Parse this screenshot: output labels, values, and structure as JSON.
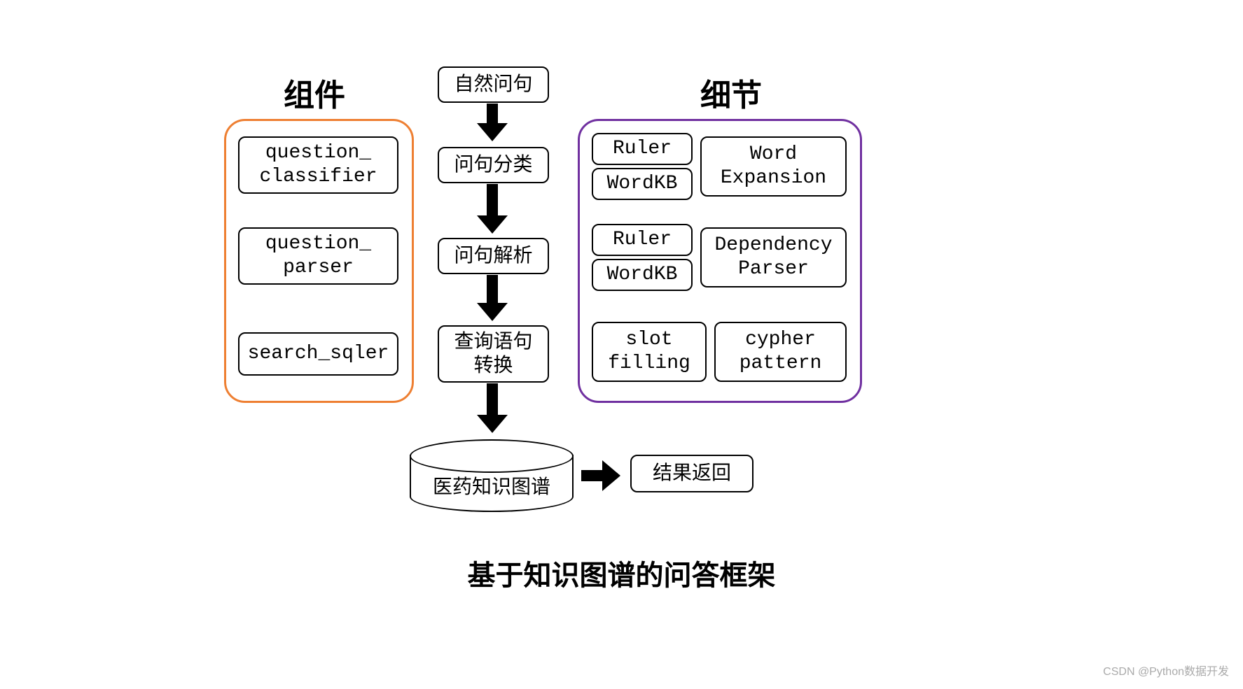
{
  "headers": {
    "left": "组件",
    "right": "细节"
  },
  "center": {
    "natural_question": "自然问句",
    "q_classify": "问句分类",
    "q_parse": "问句解析",
    "query_convert_l1": "查询语句",
    "query_convert_l2": "转换",
    "kg": "医药知识图谱",
    "result": "结果返回"
  },
  "left": {
    "comp1_l1": "question_",
    "comp1_l2": "classifier",
    "comp2_l1": "question_",
    "comp2_l2": "parser",
    "comp3": "search_sqler"
  },
  "right": {
    "r1a": "Ruler",
    "r1b": "WordKB",
    "r1c_l1": "Word",
    "r1c_l2": "Expansion",
    "r2a": "Ruler",
    "r2b": "WordKB",
    "r2c_l1": "Dependency",
    "r2c_l2": "Parser",
    "r3a_l1": "slot",
    "r3a_l2": "filling",
    "r3b_l1": "cypher",
    "r3b_l2": "pattern"
  },
  "title": "基于知识图谱的问答框架",
  "watermark": "CSDN @Python数据开发"
}
